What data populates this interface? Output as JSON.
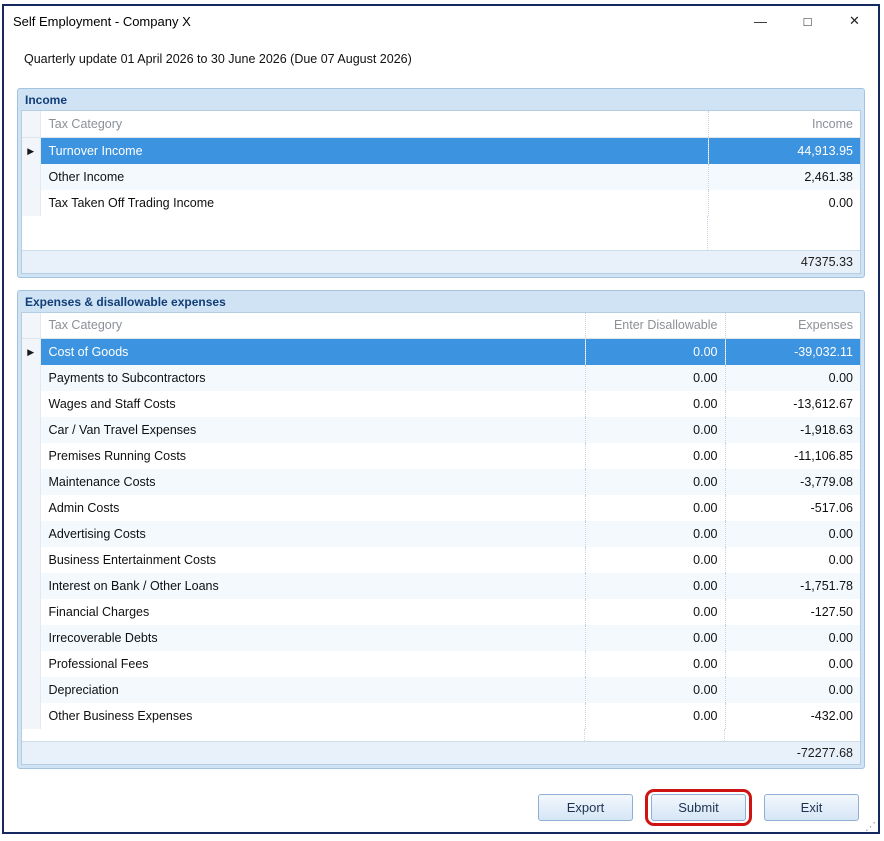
{
  "window": {
    "title": "Self Employment - Company X",
    "subtitle": "Quarterly update 01 April 2026 to 30 June 2026 (Due 07 August 2026)"
  },
  "icons": {
    "row_marker": "▶",
    "minimize": "—",
    "maximize": "□",
    "close": "✕",
    "resize_grip": "⋰"
  },
  "income": {
    "header": "Income",
    "columns": {
      "category": "Tax Category",
      "income": "Income"
    },
    "rows": [
      {
        "category": "Turnover Income",
        "income": "44,913.95",
        "selected": true
      },
      {
        "category": "Other Income",
        "income": "2,461.38"
      },
      {
        "category": "Tax Taken Off Trading Income",
        "income": "0.00"
      }
    ],
    "total": "47375.33"
  },
  "expenses": {
    "header": "Expenses & disallowable expenses",
    "columns": {
      "category": "Tax Category",
      "disallowable": "Enter Disallowable",
      "expenses": "Expenses"
    },
    "rows": [
      {
        "category": "Cost of Goods",
        "disallowable": "0.00",
        "expenses": "-39,032.11",
        "selected": true
      },
      {
        "category": "Payments to Subcontractors",
        "disallowable": "0.00",
        "expenses": "0.00"
      },
      {
        "category": "Wages and Staff Costs",
        "disallowable": "0.00",
        "expenses": "-13,612.67"
      },
      {
        "category": "Car / Van Travel Expenses",
        "disallowable": "0.00",
        "expenses": "-1,918.63"
      },
      {
        "category": "Premises Running Costs",
        "disallowable": "0.00",
        "expenses": "-11,106.85"
      },
      {
        "category": "Maintenance Costs",
        "disallowable": "0.00",
        "expenses": "-3,779.08"
      },
      {
        "category": "Admin Costs",
        "disallowable": "0.00",
        "expenses": "-517.06"
      },
      {
        "category": "Advertising Costs",
        "disallowable": "0.00",
        "expenses": "0.00"
      },
      {
        "category": "Business Entertainment Costs",
        "disallowable": "0.00",
        "expenses": "0.00"
      },
      {
        "category": "Interest on Bank / Other Loans",
        "disallowable": "0.00",
        "expenses": "-1,751.78"
      },
      {
        "category": "Financial Charges",
        "disallowable": "0.00",
        "expenses": "-127.50"
      },
      {
        "category": "Irrecoverable Debts",
        "disallowable": "0.00",
        "expenses": "0.00"
      },
      {
        "category": "Professional Fees",
        "disallowable": "0.00",
        "expenses": "0.00"
      },
      {
        "category": "Depreciation",
        "disallowable": "0.00",
        "expenses": "0.00"
      },
      {
        "category": "Other Business Expenses",
        "disallowable": "0.00",
        "expenses": "-432.00"
      }
    ],
    "total": "-72277.68"
  },
  "buttons": {
    "export": "Export",
    "submit": "Submit",
    "exit": "Exit"
  },
  "colors": {
    "selection": "#3c93df",
    "group_background": "#cfe3f5",
    "group_header_text": "#123e77",
    "annotation_ring": "#cf1212",
    "window_border": "#16295f"
  }
}
